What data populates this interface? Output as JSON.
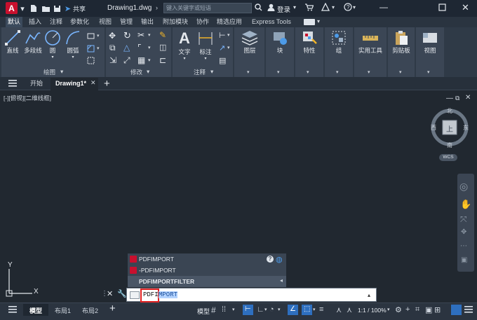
{
  "titlebar": {
    "share_label": "共享",
    "document_title": "Drawing1.dwg",
    "search_placeholder": "键入关键字或短语",
    "login_label": "登录"
  },
  "ribbon_tabs": [
    {
      "label": "默认",
      "active": true
    },
    {
      "label": "插入",
      "active": false
    },
    {
      "label": "注释",
      "active": false
    },
    {
      "label": "参数化",
      "active": false
    },
    {
      "label": "视图",
      "active": false
    },
    {
      "label": "管理",
      "active": false
    },
    {
      "label": "输出",
      "active": false
    },
    {
      "label": "附加模块",
      "active": false
    },
    {
      "label": "协作",
      "active": false
    },
    {
      "label": "精选应用",
      "active": false
    },
    {
      "label": "Express Tools",
      "active": false
    }
  ],
  "ribbon": {
    "draw_panel_label": "绘图",
    "modify_panel_label": "修改",
    "annotation_panel_label": "注释",
    "tools": {
      "line": "直线",
      "polyline": "多段线",
      "circle": "圆",
      "arc": "圆弧",
      "text": "文字",
      "dimension": "标注",
      "layers": "图层",
      "block": "块",
      "properties": "特性",
      "group": "组",
      "utilities": "实用工具",
      "clipboard": "剪贴板",
      "view": "视图"
    }
  },
  "doc_tabs": {
    "start": "开始",
    "drawing": "Drawing1*"
  },
  "viewport": {
    "view_label": "[-][俯视][二维线框]",
    "compass": {
      "north": "北",
      "south": "南",
      "west": "西",
      "east": "东",
      "center": "上"
    },
    "wcs_label": "WCS",
    "axis_x": "X",
    "axis_y": "Y"
  },
  "autocomplete": [
    {
      "label": "PDFIMPORT"
    },
    {
      "label": "-PDFIMPORT"
    },
    {
      "label": "PDFIMPORTFILTER"
    }
  ],
  "command": {
    "typed": "PDFI",
    "suggested_completion": "MPORT"
  },
  "statusbar": {
    "model_tab": "模型",
    "layout1": "布局1",
    "layout2": "布局2",
    "model_button": "模型",
    "scale": "1:1 / 100%"
  },
  "colors": {
    "accent": "#c8102e",
    "active_tab": "#3b4a5c",
    "highlight": "#2e6fbf"
  }
}
